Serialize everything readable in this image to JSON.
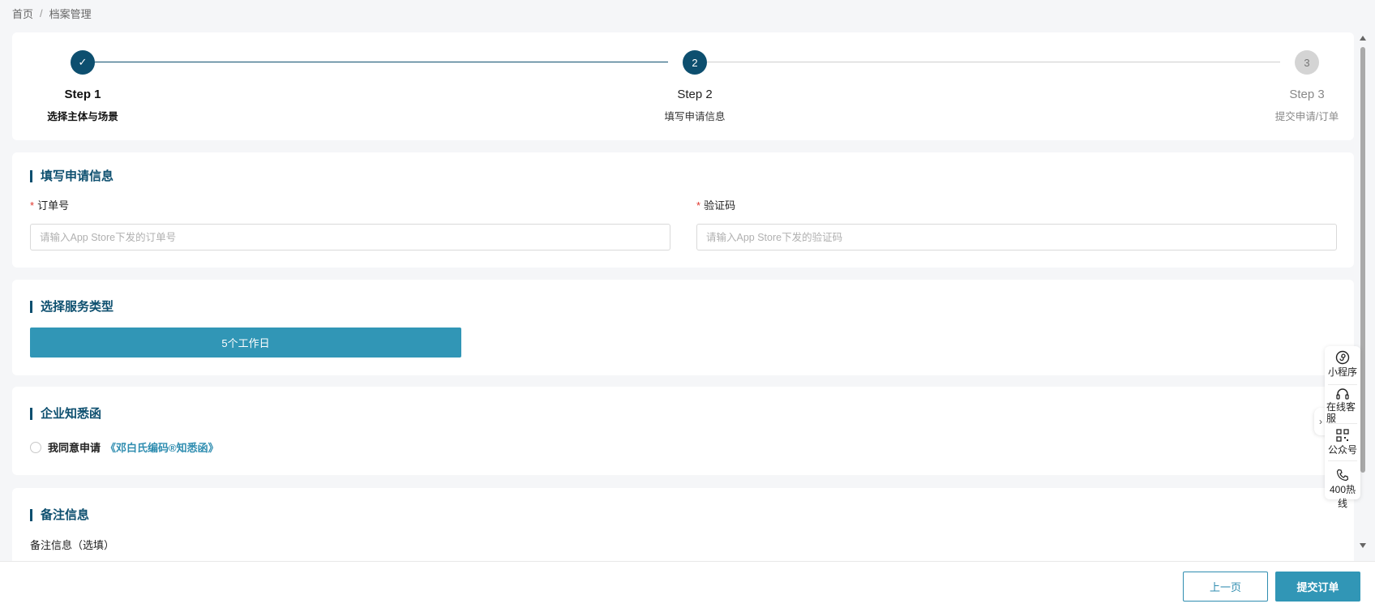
{
  "breadcrumb": {
    "home": "首页",
    "separator": "/",
    "current": "档案管理"
  },
  "steps": [
    {
      "number": "✓",
      "title": "Step 1",
      "desc": "选择主体与场景",
      "state": "done"
    },
    {
      "number": "2",
      "title": "Step 2",
      "desc": "填写申请信息",
      "state": "active"
    },
    {
      "number": "3",
      "title": "Step 3",
      "desc": "提交申请/订单",
      "state": "pending"
    }
  ],
  "form": {
    "title": "填写申请信息",
    "order": {
      "required": "*",
      "label": "订单号",
      "placeholder": "请输入App Store下发的订单号",
      "value": ""
    },
    "code": {
      "required": "*",
      "label": "验证码",
      "placeholder": "请输入App Store下发的验证码",
      "value": ""
    }
  },
  "service": {
    "title": "选择服务类型",
    "option": "5个工作日"
  },
  "notice": {
    "title": "企业知悉函",
    "agree_text": "我同意申请",
    "link_text": "《邓白氏编码®知悉函》"
  },
  "remark": {
    "title": "备注信息",
    "label": "备注信息（选填）"
  },
  "side_panel": {
    "toggle": "›",
    "items": [
      {
        "label": "小程序",
        "icon": "mini-program-icon"
      },
      {
        "label": "在线客服",
        "icon": "headset-icon"
      },
      {
        "label": "公众号",
        "icon": "qr-code-icon"
      },
      {
        "label": "400热线",
        "icon": "phone-icon"
      }
    ]
  },
  "footer": {
    "prev_label": "上一页",
    "submit_label": "提交订单"
  },
  "colors": {
    "primary": "#0d4f6f",
    "accent": "#3196b6",
    "link": "#2f8db0",
    "required": "#e0352b"
  }
}
